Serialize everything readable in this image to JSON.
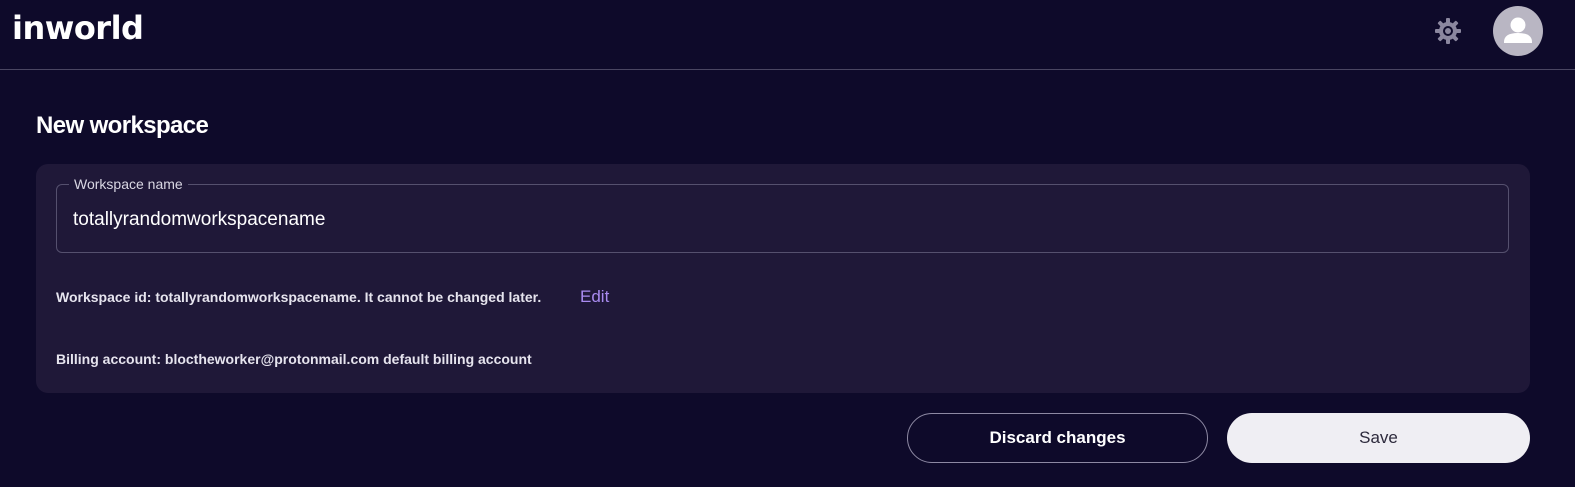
{
  "header": {
    "logo_text": "inworld",
    "settings_icon": "gear-icon",
    "avatar_icon": "user-icon"
  },
  "page": {
    "title": "New workspace"
  },
  "form": {
    "workspace_name_label": "Workspace name",
    "workspace_name_value": "totallyrandomworkspacename",
    "workspace_id_text": "Workspace id: totallyrandomworkspacename. It cannot be changed later.",
    "edit_label": "Edit",
    "billing_text": "Billing account: bloctheworker@protonmail.com default billing account"
  },
  "actions": {
    "discard_label": "Discard changes",
    "save_label": "Save"
  },
  "colors": {
    "background": "#0e0a2a",
    "card": "#1f1838",
    "accent_link": "#a98bf0",
    "save_button": "#efeef3"
  }
}
